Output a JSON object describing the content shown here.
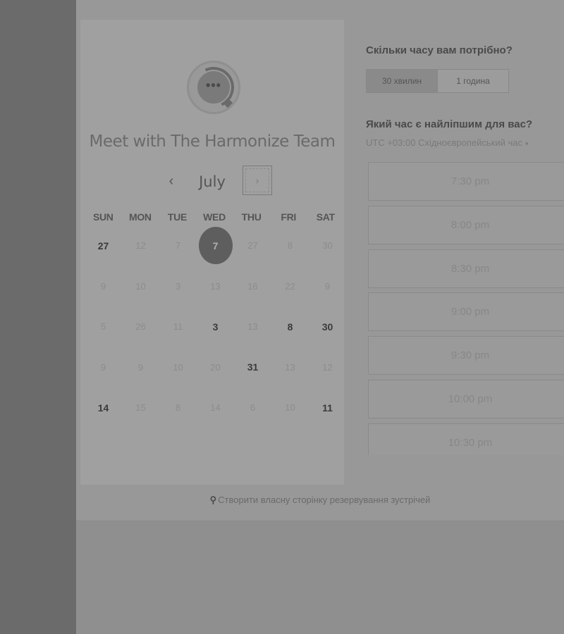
{
  "calendar": {
    "title": "Meet with The Harmonize Team",
    "avatar_dots": "•••",
    "month": "July",
    "prev_label": "‹",
    "next_label": "›",
    "weekdays": [
      "SUN",
      "MON",
      "TUE",
      "WED",
      "THU",
      "FRI",
      "SAT"
    ],
    "weeks": [
      [
        {
          "d": "27",
          "on": true
        },
        {
          "d": "12",
          "on": false
        },
        {
          "d": "7",
          "on": false
        },
        {
          "d": "7",
          "on": true,
          "sel": true
        },
        {
          "d": "27",
          "on": false
        },
        {
          "d": "8",
          "on": false
        },
        {
          "d": "30",
          "on": false
        }
      ],
      [
        {
          "d": "9",
          "on": false
        },
        {
          "d": "10",
          "on": false
        },
        {
          "d": "3",
          "on": false
        },
        {
          "d": "13",
          "on": false
        },
        {
          "d": "16",
          "on": false
        },
        {
          "d": "22",
          "on": false
        },
        {
          "d": "9",
          "on": false
        }
      ],
      [
        {
          "d": "5",
          "on": false
        },
        {
          "d": "26",
          "on": false
        },
        {
          "d": "11",
          "on": false
        },
        {
          "d": "3",
          "on": true
        },
        {
          "d": "13",
          "on": false
        },
        {
          "d": "8",
          "on": true
        },
        {
          "d": "30",
          "on": true
        }
      ],
      [
        {
          "d": "9",
          "on": false
        },
        {
          "d": "9",
          "on": false
        },
        {
          "d": "10",
          "on": false
        },
        {
          "d": "20",
          "on": false
        },
        {
          "d": "31",
          "on": true
        },
        {
          "d": "13",
          "on": false
        },
        {
          "d": "12",
          "on": false
        }
      ],
      [
        {
          "d": "14",
          "on": true
        },
        {
          "d": "15",
          "on": false
        },
        {
          "d": "8",
          "on": false
        },
        {
          "d": "14",
          "on": false
        },
        {
          "d": "6",
          "on": false
        },
        {
          "d": "10",
          "on": false
        },
        {
          "d": "11",
          "on": true
        }
      ]
    ]
  },
  "duration": {
    "heading": "Скільки часу вам потрібно?",
    "options": [
      "30 хвилин",
      "1 година"
    ],
    "selected_index": 0
  },
  "time": {
    "heading": "Який час є найліпшим для вас?",
    "timezone": "UTC +03:00 Східноєвропейський час",
    "timezone_caret": "▾",
    "slots": [
      "7:30 pm",
      "8:00 pm",
      "8:30 pm",
      "9:00 pm",
      "9:30 pm",
      "10:00 pm",
      "10:30 pm"
    ]
  },
  "footer": {
    "icon": "hubspot-sprocket-icon",
    "glyph": "⚲",
    "link_text": "Створити власну сторінку резервування зустрічей"
  }
}
